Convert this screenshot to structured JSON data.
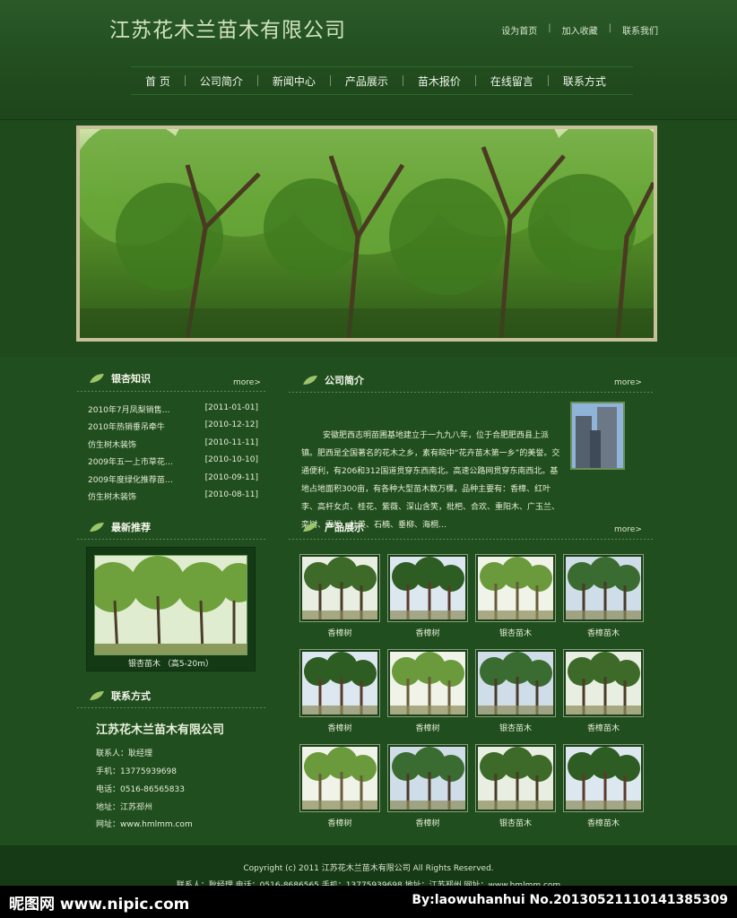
{
  "header": {
    "site_title": "江苏花木兰苗木有限公司",
    "top_links": [
      "设为首页",
      "加入收藏",
      "联系我们"
    ]
  },
  "nav": [
    "首 页",
    "公司简介",
    "新闻中心",
    "产品展示",
    "苗木报价",
    "在线留言",
    "联系方式"
  ],
  "news": {
    "title": "银杏知识",
    "more": "more>",
    "items": [
      {
        "title": "2010年7月凤梨销售…",
        "date": "[2011-01-01]"
      },
      {
        "title": "2010年热销垂吊牵牛",
        "date": "[2010-12-12]"
      },
      {
        "title": "仿生树木装饰",
        "date": "[2010-11-11]"
      },
      {
        "title": "2009年五一上市草花…",
        "date": "[2010-10-10]"
      },
      {
        "title": "2009年度绿化推荐苗…",
        "date": "[2010-09-11]"
      },
      {
        "title": "仿生树木装饰",
        "date": "[2010-08-11]"
      }
    ]
  },
  "recommend": {
    "title": "最新推荐",
    "caption": "银杏苗木 （高5-20m）"
  },
  "contact": {
    "title": "联系方式",
    "company": "江苏花木兰苗木有限公司",
    "lines": [
      "联系人：耿经理",
      "手机：13775939698",
      "电话：0516-86565833",
      "地址：江苏邳州",
      "网址：www.hmlmm.com"
    ]
  },
  "intro": {
    "title": "公司简介",
    "more": "more>",
    "text": "安徽肥西志明苗圃基地建立于一九九八年，位于合肥肥西县上派镇。肥西是全国著名的花木之乡，素有皖中“花卉苗木第一乡”的美誉。交通便利，有206和312国道贯穿东西南北。高速公路网贯穿东南西北。基地占地面积300亩，有各种大型苗木数万棵，品种主要有：香樟、红叶李、高杆女贞、桂花、紫薇、深山含笑，枇杷、合欢、重阳木、广玉兰、栾树、雪松、杜英、石楠、垂柳、海桐…"
  },
  "products": {
    "title": "产品展示",
    "more": "more>",
    "items": [
      "香樟树",
      "香樟树",
      "银杏苗木",
      "香樟苗木",
      "香樟树",
      "香樟树",
      "银杏苗木",
      "香樟苗木",
      "香樟树",
      "香樟树",
      "银杏苗木",
      "香樟苗木"
    ]
  },
  "footer": {
    "line1": "Copyright (c) 2011  江苏花木兰苗木有限公司  All Rights Reserved.",
    "line2": "联系人：耿经理    电话：0516-8686565    手机：13775939698    地址：江苏邳州    网址：www.hmlmm.com"
  },
  "watermark": {
    "left": "昵图网 www.nipic.com",
    "right": "By:laowuhanhui  No.20130521110141385309"
  },
  "colors": {
    "background": "#1f4a1c",
    "header": "#2b5a28",
    "footer": "#163a15",
    "banner_border": "#c7c19a"
  }
}
